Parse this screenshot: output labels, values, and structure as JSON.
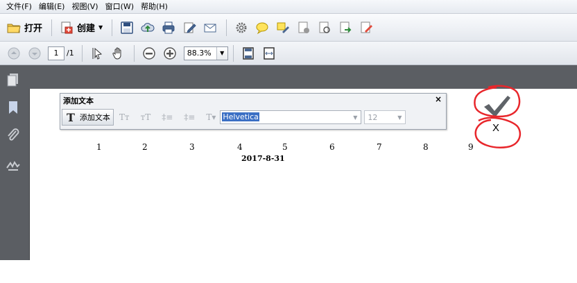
{
  "menu": [
    "文件(F)",
    "编辑(E)",
    "视图(V)",
    "窗口(W)",
    "帮助(H)"
  ],
  "toolbar": {
    "open_label": "打开",
    "create_label": "创建",
    "icons": [
      "folder-icon",
      "create-pdf-icon",
      "save-icon",
      "upload-cloud-icon",
      "print-icon",
      "edit-icon",
      "email-icon",
      "settings-icon",
      "comment-icon",
      "highlight-icon",
      "pdf-tools-icon",
      "review-icon",
      "export-icon",
      "sign-icon"
    ]
  },
  "nav": {
    "page_value": "1",
    "page_total": "/1",
    "zoom_value": "88.3%"
  },
  "text_panel": {
    "title": "添加文本",
    "close": "×",
    "tool_label": "添加文本",
    "font_value": "Helvetica",
    "size_value": "12"
  },
  "document": {
    "numbers": [
      "1",
      "2",
      "3",
      "4",
      "5",
      "6",
      "7",
      "8",
      "9"
    ],
    "date": "2017-8-31",
    "x_mark": "X"
  },
  "colors": {
    "accent_red": "#e8262b",
    "panel_gray": "#5b5e63",
    "selection_blue": "#3b6fc4"
  }
}
